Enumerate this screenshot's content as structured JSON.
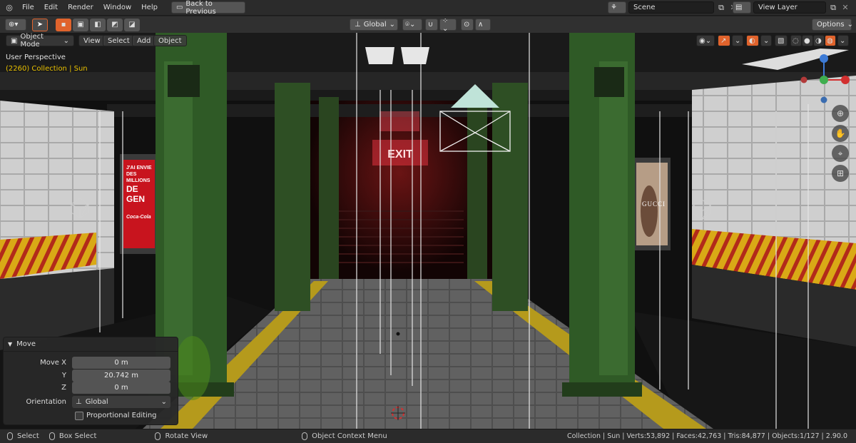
{
  "topbar": {
    "menus": [
      "File",
      "Edit",
      "Render",
      "Window",
      "Help"
    ],
    "back_button": "Back to Previous",
    "scene_label": "Scene",
    "view_layer_label": "View Layer"
  },
  "header": {
    "orientation": "Global",
    "options": "Options"
  },
  "viewport_header": {
    "mode": "Object Mode",
    "menus": [
      "View",
      "Select",
      "Add",
      "Object"
    ]
  },
  "viewport": {
    "perspective": "User Perspective",
    "collection_info": "(2260) Collection | Sun",
    "exit_sign": "EXIT",
    "poster_left": [
      "J'AI ENVIE",
      "DES MILLIONS",
      "DE GEN"
    ],
    "poster_left_brand": "Coca-Cola",
    "poster_right": "GUCCI"
  },
  "move_panel": {
    "title": "Move",
    "move_x_label": "Move X",
    "move_x": "0 m",
    "y_label": "Y",
    "y": "20.742 m",
    "z_label": "Z",
    "z": "0 m",
    "orientation_label": "Orientation",
    "orientation": "Global",
    "proportional": "Proportional Editing"
  },
  "status": {
    "select": "Select",
    "box_select": "Box Select",
    "rotate": "Rotate View",
    "context_menu": "Object Context Menu",
    "stats": "Collection | Sun | Verts:53,892 | Faces:42,763 | Tris:84,877 | Objects:1/127 | 2.90.0"
  },
  "colors": {
    "accent": "#e0632c",
    "exit_red": "#ff3a4a",
    "pillar_green": "#2f5a26",
    "hazard_yellow": "#e0b21a",
    "info_yellow": "#e8c000"
  }
}
